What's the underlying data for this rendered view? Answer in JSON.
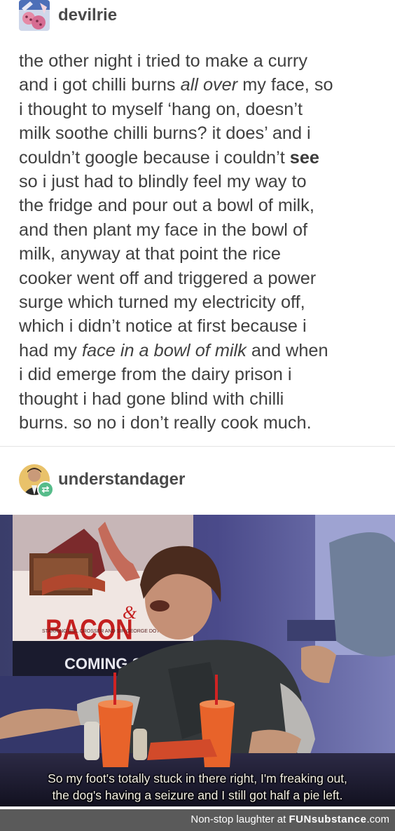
{
  "post1": {
    "username": "devilrie",
    "lines": [
      "the other night i tried to make a curry",
      "and i got chilli burns ",
      "all over",
      " my face, so",
      "i thought to myself ‘hang on, doesn’t",
      "milk soothe chilli burns? it does’ and i",
      "couldn’t google because i couldn’t ",
      "see",
      "so i just had to blindly feel my way to",
      "the fridge and pour out a bowl of milk,",
      "and then plant my face in the bowl of",
      "milk, anyway at that point the rice",
      "cooker went off and triggered a power",
      "surge which turned my electricity off,",
      "which i didn’t notice at first because i",
      "had my ",
      "face in a bowl of milk",
      " and when",
      "i did emerge from the dairy prison i",
      "thought i had gone blind with chilli",
      "burns. so no i don’t really cook much."
    ]
  },
  "post2": {
    "username": "understandager",
    "image": {
      "poster_title": "BACON",
      "poster_ampersand": "&",
      "poster_small_text": "STARRING BILL CROSSER AND SIR GEORGE DOTT",
      "coming_soon_text": "COMING S",
      "caption_line1": "So my foot's totally stuck in there right, I'm freaking out,",
      "caption_line2": "the dog's having a seizure and I still got half a pie left."
    }
  },
  "footer": {
    "prefix": "Non-stop laughter at ",
    "brand": "FUNsubstance",
    "suffix": ".com"
  },
  "colors": {
    "text": "#404040",
    "reblog_green": "#56bc8a",
    "footer_bg": "#5a5a5a"
  },
  "icons": [
    "devilrie-avatar",
    "understandager-avatar",
    "reblog-icon"
  ]
}
